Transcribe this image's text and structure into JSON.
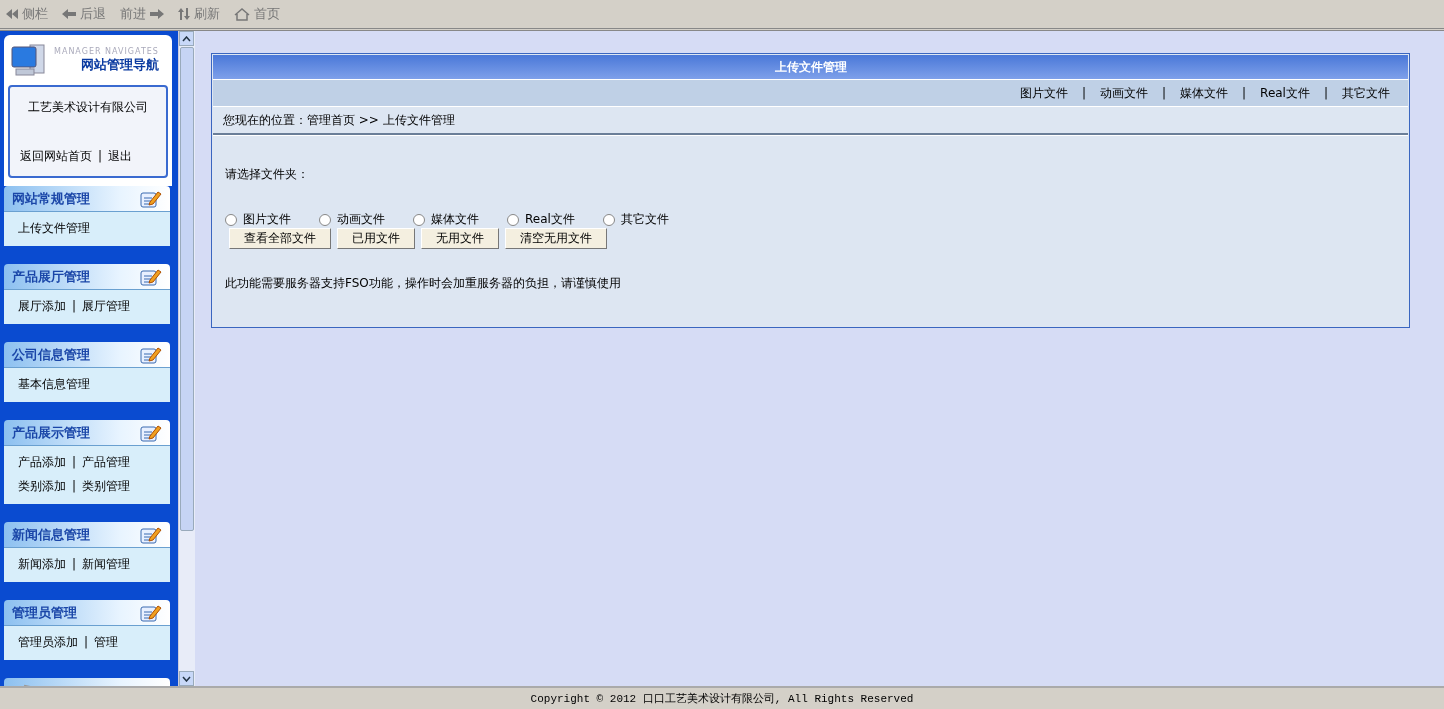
{
  "toolbar": [
    {
      "kind": "sidebar",
      "label": "侧栏"
    },
    {
      "kind": "back",
      "label": "后退"
    },
    {
      "kind": "forward",
      "label": "前进"
    },
    {
      "kind": "refresh",
      "label": "刷新"
    },
    {
      "kind": "home",
      "label": "首页"
    }
  ],
  "sidebar": {
    "brand_en": "MANAGER NAVIGATES",
    "title": "网站管理导航",
    "company": "工艺美术设计有限公司",
    "links": [
      "返回网站首页",
      "退出"
    ],
    "separator": "|",
    "sections": [
      {
        "kind": "edit",
        "title": "网站常规管理",
        "rows": [
          [
            "上传文件管理"
          ]
        ]
      },
      {
        "kind": "edit",
        "title": "产品展厅管理",
        "rows": [
          [
            "展厅添加",
            "展厅管理"
          ]
        ]
      },
      {
        "kind": "edit",
        "title": "公司信息管理",
        "rows": [
          [
            "基本信息管理"
          ]
        ]
      },
      {
        "kind": "edit",
        "title": "产品展示管理",
        "rows": [
          [
            "产品添加",
            "产品管理"
          ],
          [
            "类别添加",
            "类别管理"
          ]
        ]
      },
      {
        "kind": "edit",
        "title": "新闻信息管理",
        "rows": [
          [
            "新闻添加",
            "新闻管理"
          ]
        ]
      },
      {
        "kind": "edit",
        "title": "管理员管理",
        "rows": [
          [
            "管理员添加",
            "管理"
          ]
        ]
      },
      {
        "kind": "tools"
      }
    ]
  },
  "panel": {
    "title": "上传文件管理",
    "tabs": [
      "图片文件",
      "动画文件",
      "媒体文件",
      "Real文件",
      "其它文件"
    ],
    "tab_separator": "|",
    "breadcrumb": "您现在的位置：管理首页 >> 上传文件管理",
    "prompt": "请选择文件夹：",
    "folders": [
      {
        "label": "图片文件",
        "selected": false
      },
      {
        "label": "动画文件",
        "selected": false
      },
      {
        "label": "媒体文件",
        "selected": false
      },
      {
        "label": "Real文件",
        "selected": false
      },
      {
        "label": "其它文件",
        "selected": false
      }
    ],
    "buttons": [
      "查看全部文件",
      "已用文件",
      "无用文件",
      "清空无用文件"
    ],
    "note": "此功能需要服务器支持FSO功能，操作时会加重服务器的负担，请谨慎使用"
  },
  "footer": "Copyright © 2012 口口工艺美术设计有限公司, All Rights Reserved"
}
